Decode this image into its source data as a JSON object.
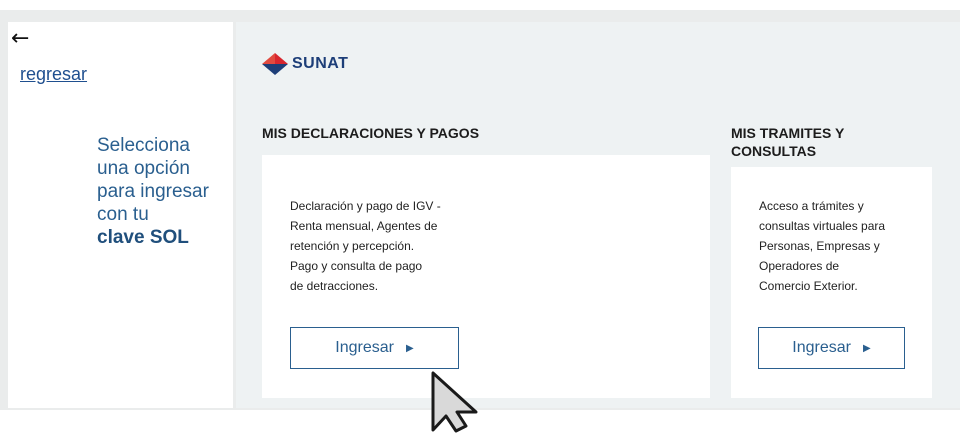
{
  "nav": {
    "back_arrow": "←",
    "back_label": "regresar"
  },
  "prompt": {
    "line1": "Selecciona una opción para ingresar con tu",
    "line2": "clave SOL"
  },
  "brand": {
    "name": "SUNAT",
    "colors": {
      "red": "#d8262e",
      "blue": "#1d3e78"
    }
  },
  "sections": [
    {
      "title": "MIS DECLARACIONES Y PAGOS",
      "text": "Declaración y pago de IGV -\nRenta mensual, Agentes de\nretención y percepción.\nPago y consulta de pago\nde detracciones.",
      "button": "Ingresar",
      "button_icon": "caret-right-icon"
    },
    {
      "title": "MIS TRAMITES Y\nCONSULTAS",
      "text": "Acceso a trámites y\nconsultas virtuales para\nPersonas, Empresas y\nOperadores de\nComercio Exterior.",
      "button": "Ingresar",
      "button_icon": "caret-right-icon"
    }
  ],
  "accent": "#2a5f8f",
  "cursor_icon": "mouse-pointer-icon"
}
